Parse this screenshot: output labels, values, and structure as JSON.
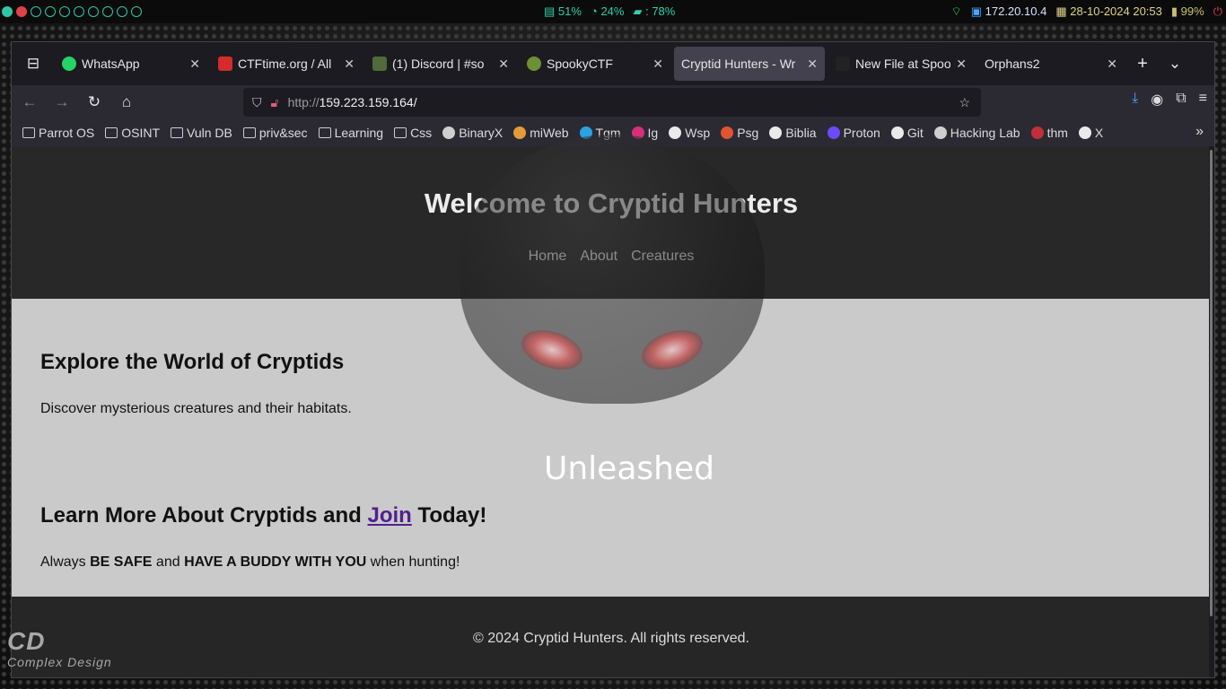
{
  "system_bar": {
    "stats": [
      "51%",
      "24%",
      ": 78%"
    ],
    "ip": "172.20.10.4",
    "datetime": "28-10-2024 20:53",
    "battery": "99%"
  },
  "browser": {
    "tabs": [
      {
        "label": "WhatsApp",
        "color": "#25d366"
      },
      {
        "label": "CTFtime.org / All",
        "color": "#d42b2b"
      },
      {
        "label": "(1) Discord | #so",
        "color": "#4e6b3a"
      },
      {
        "label": "SpookyCTF",
        "color": "#6f8f35"
      },
      {
        "label": "Cryptid Hunters - Wr",
        "color": "#42414d"
      },
      {
        "label": "New File at Spool",
        "color": "#222222"
      },
      {
        "label": "Orphans2",
        "color": "#1c1b22"
      }
    ],
    "url": {
      "prefix": "http://",
      "host": "159.223.159.164/"
    },
    "bookmarks": [
      {
        "label": "Parrot OS",
        "icon": "folder-icon"
      },
      {
        "label": "OSINT",
        "icon": "folder-icon"
      },
      {
        "label": "Vuln DB",
        "icon": "folder-icon"
      },
      {
        "label": "priv&sec",
        "icon": "folder-icon"
      },
      {
        "label": "Learning",
        "icon": "folder-icon"
      },
      {
        "label": "Css",
        "icon": "folder-icon"
      },
      {
        "label": "BinaryX",
        "icon": "binaryx-icon"
      },
      {
        "label": "miWeb",
        "icon": "miweb-icon"
      },
      {
        "label": "Tgm",
        "icon": "telegram-icon"
      },
      {
        "label": "Ig",
        "icon": "instagram-icon"
      },
      {
        "label": "Wsp",
        "icon": "whatsapp-icon"
      },
      {
        "label": "Psg",
        "icon": "psg-icon"
      },
      {
        "label": "Biblia",
        "icon": "biblia-icon"
      },
      {
        "label": "Proton",
        "icon": "proton-icon"
      },
      {
        "label": "Git",
        "icon": "github-icon"
      },
      {
        "label": "Hacking Lab",
        "icon": "globe-icon"
      },
      {
        "label": "thm",
        "icon": "thm-icon"
      },
      {
        "label": "X",
        "icon": "x-icon"
      }
    ]
  },
  "page": {
    "title": "Welcome to Cryptid Hunters",
    "nav": [
      "Home",
      "About",
      "Creatures"
    ],
    "section1": {
      "heading": "Explore the World of Cryptids",
      "text": "Discover mysterious creatures and their habitats."
    },
    "section2": {
      "heading_before": "Learn More About Cryptids and ",
      "heading_link": "Join",
      "heading_after": " Today!",
      "text_1": "Always ",
      "bold_1": "BE SAFE",
      "text_2": " and ",
      "bold_2": "HAVE A BUDDY WITH YOU",
      "text_3": " when hunting!"
    },
    "footer": "© 2024 Cryptid Hunters. All rights reserved."
  },
  "wallpaper": {
    "word": "Unleashed",
    "logo_mark": "CD",
    "logo_text": "Complex Design"
  }
}
